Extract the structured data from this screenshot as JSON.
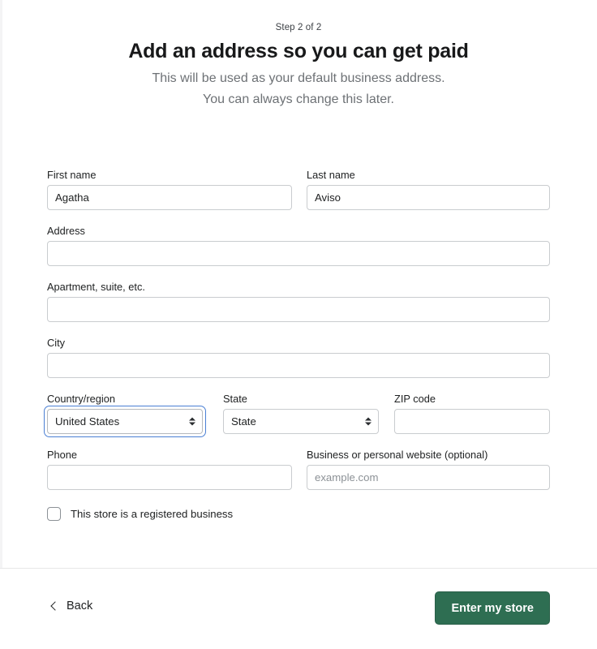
{
  "header": {
    "step": "Step 2 of 2",
    "title": "Add an address so you can get paid",
    "subtitle_line1": "This will be used as your default business address.",
    "subtitle_line2": "You can always change this later."
  },
  "form": {
    "first_name": {
      "label": "First name",
      "value": "Agatha",
      "placeholder": ""
    },
    "last_name": {
      "label": "Last name",
      "value": "Aviso",
      "placeholder": ""
    },
    "address": {
      "label": "Address",
      "value": "",
      "placeholder": ""
    },
    "apartment": {
      "label": "Apartment, suite, etc.",
      "value": "",
      "placeholder": ""
    },
    "city": {
      "label": "City",
      "value": "",
      "placeholder": ""
    },
    "country": {
      "label": "Country/region",
      "value": "United States",
      "options": [
        "United States"
      ]
    },
    "state": {
      "label": "State",
      "value": "State",
      "options": [
        "State"
      ]
    },
    "zip": {
      "label": "ZIP code",
      "value": "",
      "placeholder": ""
    },
    "phone": {
      "label": "Phone",
      "value": "",
      "placeholder": ""
    },
    "website": {
      "label": "Business or personal website (optional)",
      "value": "",
      "placeholder": "example.com"
    },
    "registered_business": {
      "label": "This store is a registered business",
      "checked": false
    }
  },
  "footer": {
    "back_label": "Back",
    "submit_label": "Enter my store"
  },
  "colors": {
    "primary_button": "#2e6e52",
    "focus_ring": "#4a7fd4",
    "input_border": "#c9cccf",
    "label_text": "#202223",
    "subtitle_text": "#6d7175",
    "placeholder_text": "#8c9196"
  }
}
